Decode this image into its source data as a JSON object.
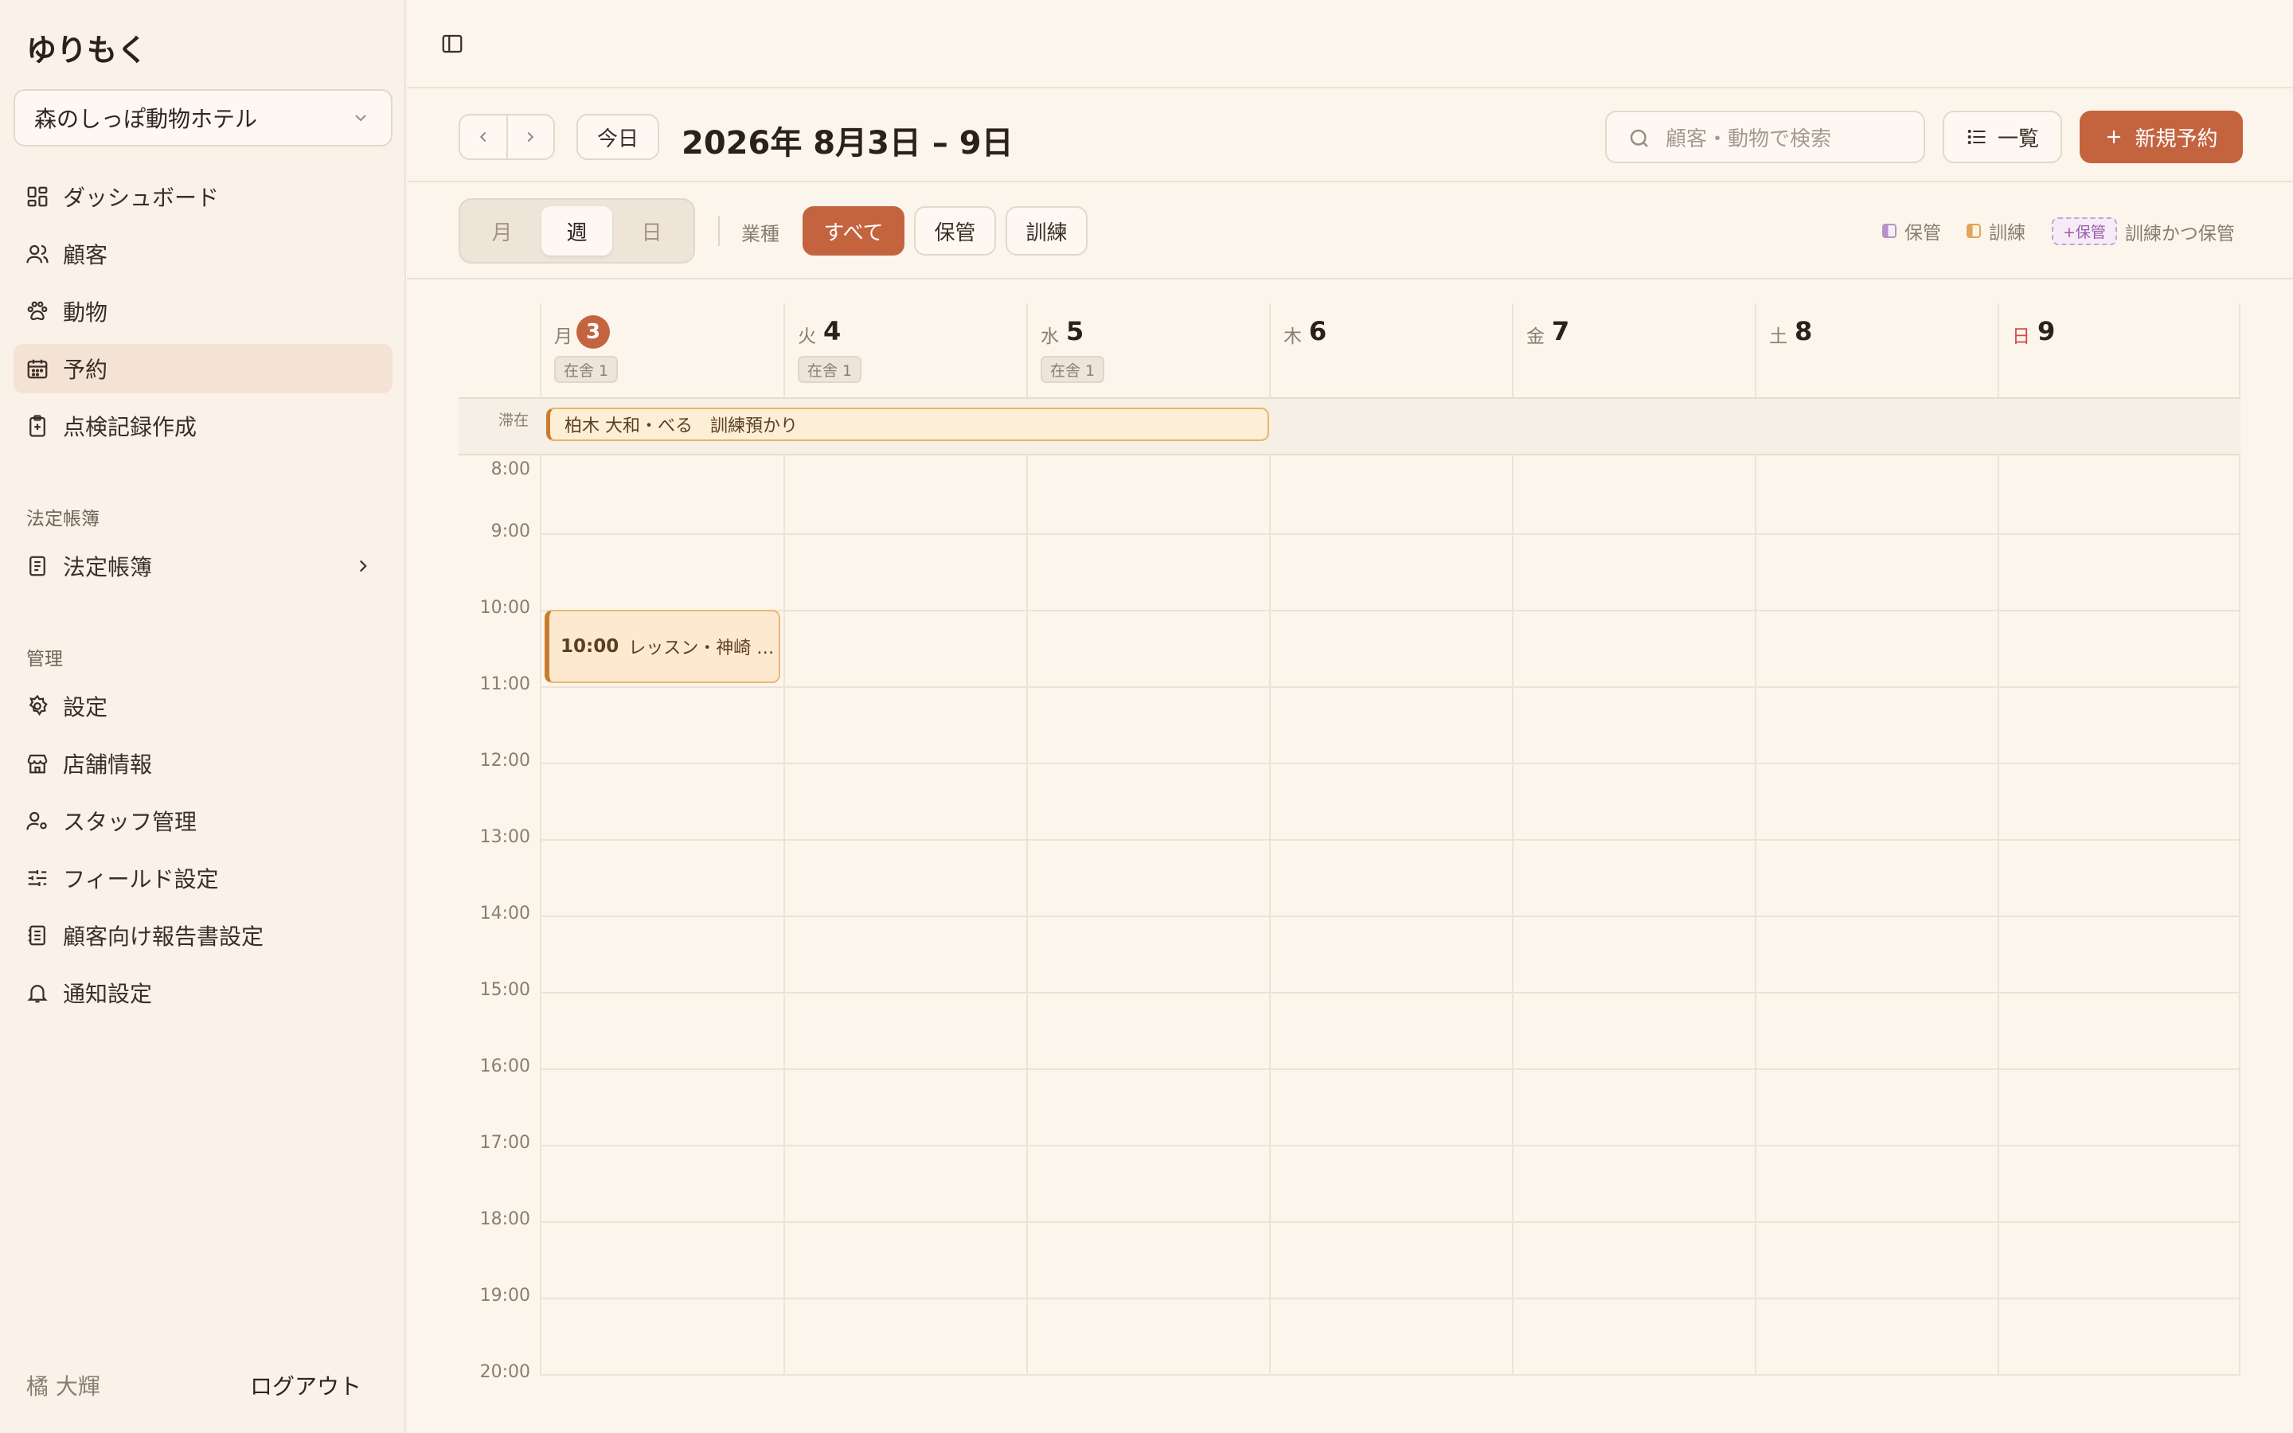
{
  "app": {
    "title": "ゆりもく"
  },
  "sidebar": {
    "store": "森のしっぽ動物ホテル",
    "items": [
      {
        "label": "ダッシュボード"
      },
      {
        "label": "顧客"
      },
      {
        "label": "動物"
      },
      {
        "label": "予約"
      },
      {
        "label": "点検記録作成"
      }
    ],
    "section_legal": "法定帳簿",
    "legal_item": "法定帳簿",
    "section_admin": "管理",
    "admin_items": [
      {
        "label": "設定"
      },
      {
        "label": "店舗情報"
      },
      {
        "label": "スタッフ管理"
      },
      {
        "label": "フィールド設定"
      },
      {
        "label": "顧客向け報告書設定"
      },
      {
        "label": "通知設定"
      }
    ],
    "user": "橘 大輝",
    "logout": "ログアウト"
  },
  "toolbar": {
    "today": "今日",
    "range": "2026年 8月3日 – 9日",
    "search_placeholder": "顧客・動物で検索",
    "list_label": "一覧",
    "new_label": "新規予約"
  },
  "filters": {
    "views": [
      "月",
      "週",
      "日"
    ],
    "active_view": "週",
    "biz_label": "業種",
    "chips": [
      "すべて",
      "保管",
      "訓練"
    ],
    "legend": {
      "hold": "保管",
      "train": "訓練",
      "both_tag": "+保管",
      "both": "訓練かつ保管"
    }
  },
  "calendar": {
    "days": [
      {
        "wd": "月",
        "num": "3",
        "stay": "在舎 1"
      },
      {
        "wd": "火",
        "num": "4",
        "stay": "在舎 1"
      },
      {
        "wd": "水",
        "num": "5",
        "stay": "在舎 1"
      },
      {
        "wd": "木",
        "num": "6",
        "stay": ""
      },
      {
        "wd": "金",
        "num": "7",
        "stay": ""
      },
      {
        "wd": "土",
        "num": "8",
        "stay": ""
      },
      {
        "wd": "日",
        "num": "9",
        "stay": ""
      }
    ],
    "allday_label": "滞在",
    "allday_event": "柏木 大和・べる　訓練預かり",
    "hours": [
      "8:00",
      "9:00",
      "10:00",
      "11:00",
      "12:00",
      "13:00",
      "14:00",
      "15:00",
      "16:00",
      "17:00",
      "18:00",
      "19:00",
      "20:00"
    ],
    "event": {
      "time": "10:00",
      "text": "レッスン・神崎 …"
    }
  }
}
